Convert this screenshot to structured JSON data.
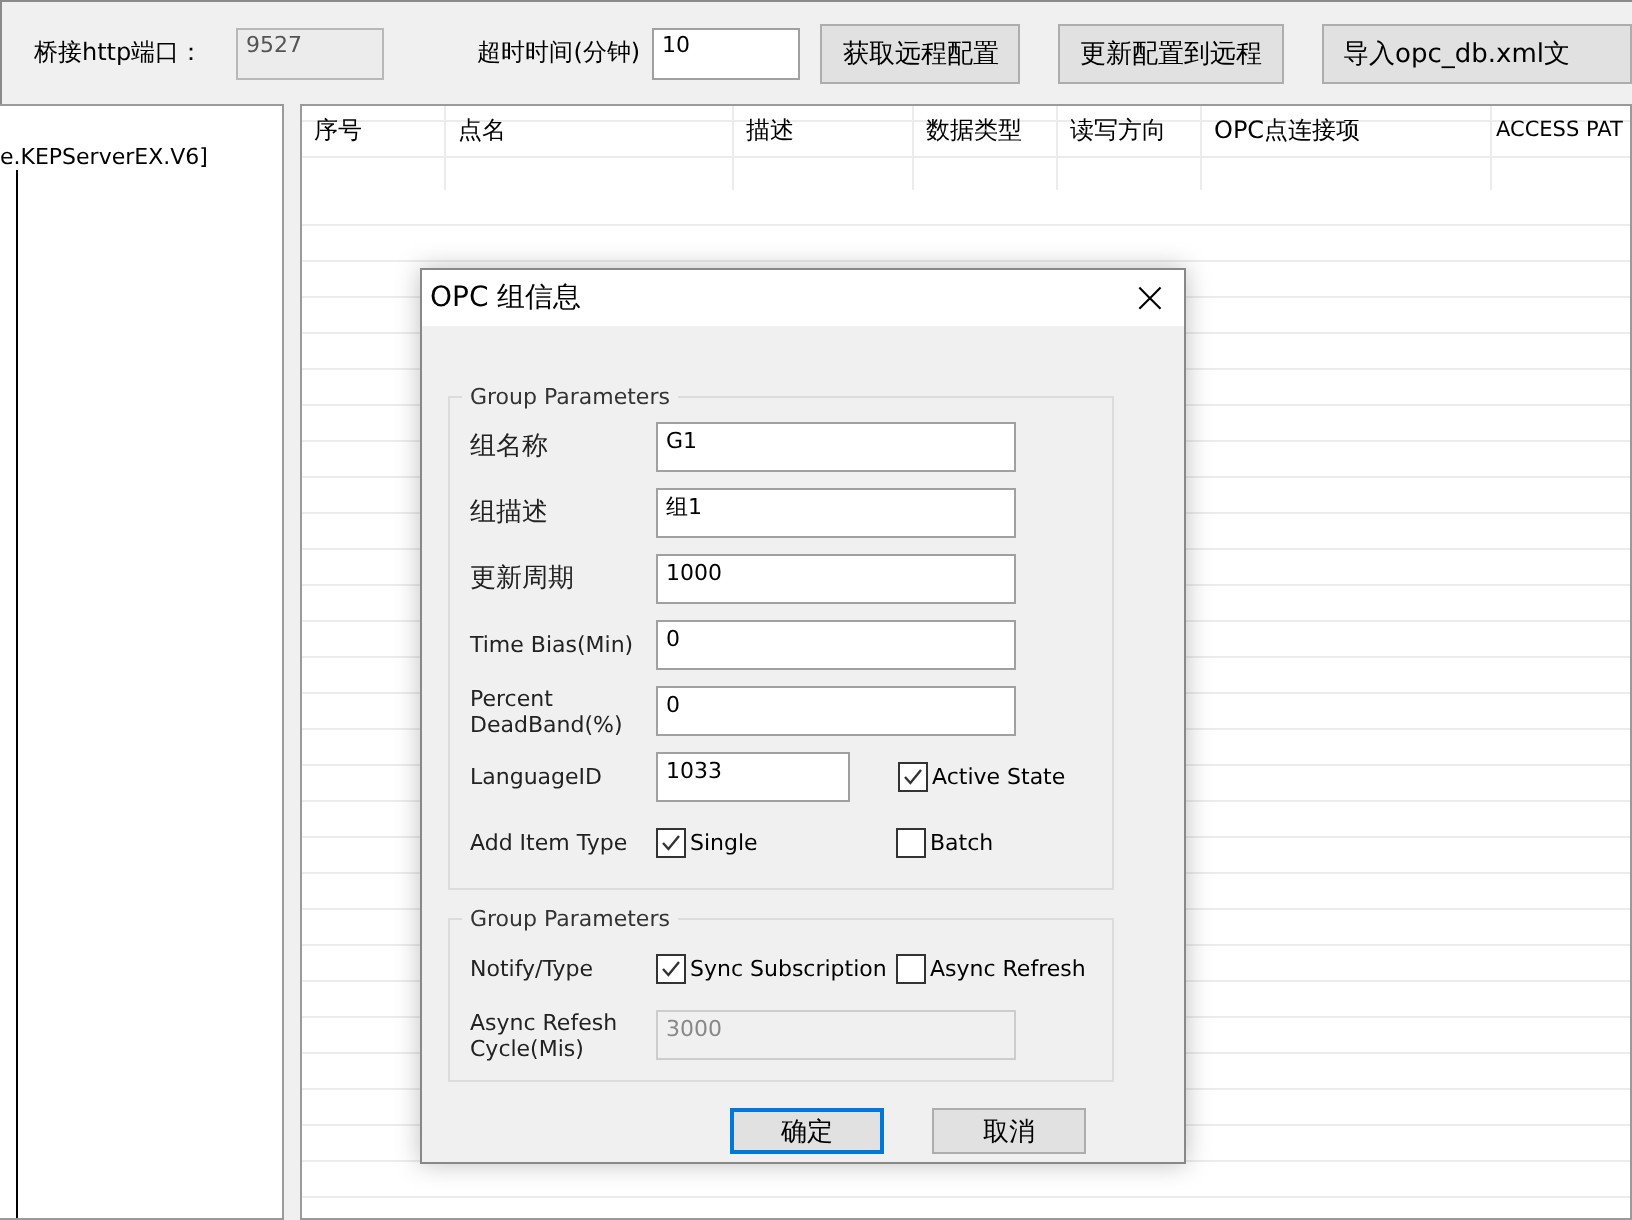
{
  "toolbar": {
    "port_label": "桥接http端口：",
    "port_field": {
      "value": "9527",
      "disabled": true
    },
    "timeout_label": "超时时间(分钟)",
    "timeout_field": {
      "value": "10",
      "disabled": false
    },
    "buttons": [
      "获取远程配置",
      "更新配置到远程",
      "导入opc_db.xml文"
    ]
  },
  "tree": {
    "items": [
      {
        "label": "e.KEPServerEX.V6]"
      }
    ]
  },
  "table": {
    "columns": [
      "序号",
      "点名",
      "描述",
      "数据类型",
      "读写方向",
      "OPC点连接项",
      "ACCESS PAT"
    ]
  },
  "dialog": {
    "title": "OPC 组信息",
    "close": "×",
    "groups": [
      {
        "title": "Group Parameters",
        "rows": [
          {
            "kind": "field",
            "label": "组名称",
            "value": "G1",
            "disabled": false
          },
          {
            "kind": "field",
            "label": "组描述",
            "value": "组1",
            "disabled": false
          },
          {
            "kind": "field",
            "label": "更新周期",
            "value": "1000",
            "disabled": false
          },
          {
            "kind": "field",
            "label": "Time Bias(Min)",
            "value": "0",
            "disabled": false
          },
          {
            "kind": "field",
            "label": "Percent DeadBand(%)",
            "value": "0",
            "disabled": false
          },
          {
            "kind": "field_option",
            "label": "LanguageID",
            "value": "1033",
            "disabled": false,
            "options": [
              {
                "label": "Active State",
                "checked": true
              }
            ]
          },
          {
            "kind": "options",
            "label": "Add Item Type",
            "options": [
              {
                "label": "Single",
                "checked": true
              },
              {
                "label": "Batch",
                "checked": false
              }
            ]
          }
        ]
      },
      {
        "title": "Group Parameters",
        "rows": [
          {
            "kind": "options",
            "label": "Notify/Type",
            "options": [
              {
                "label": "Sync Subscription",
                "checked": true
              },
              {
                "label": "Async Refresh",
                "checked": false
              }
            ]
          },
          {
            "kind": "field",
            "label": "Async Refesh Cycle(Mis)",
            "value": "3000",
            "disabled": true
          }
        ]
      }
    ],
    "buttons": [
      {
        "label": "确定",
        "default": true
      },
      {
        "label": "取消",
        "default": false
      }
    ]
  }
}
